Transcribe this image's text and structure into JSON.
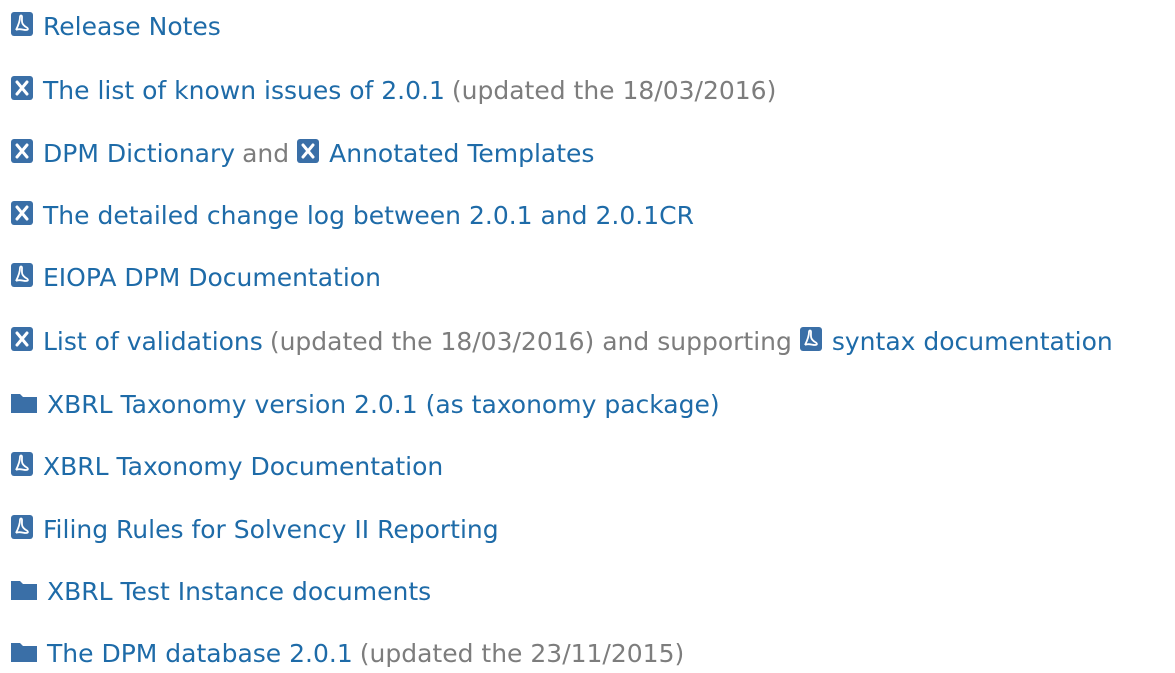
{
  "colors": {
    "link": "#1e6ba8",
    "text": "#7d7d7d",
    "icon": "#3a6fa7"
  },
  "items": [
    {
      "icon": "pdf-icon",
      "link": "Release Notes"
    },
    {
      "icon": "excel-icon",
      "link": "The list of known issues of 2.0.1",
      "note": "(updated the 18/03/2016)"
    },
    {
      "icon": "excel-icon",
      "link": "DPM Dictionary",
      "connector": "and",
      "icon2": "excel-icon",
      "link2": "Annotated Templates"
    },
    {
      "icon": "excel-icon",
      "link": "The detailed change log between 2.0.1 and 2.0.1CR"
    },
    {
      "icon": "pdf-icon",
      "link": "EIOPA DPM Documentation"
    },
    {
      "icon": "excel-icon",
      "link": "List of validations",
      "note": "(updated the 18/03/2016) and supporting",
      "icon2": "pdf-icon",
      "link2": "syntax documentation"
    },
    {
      "icon": "folder-icon",
      "link": "XBRL Taxonomy version 2.0.1 (as taxonomy package)"
    },
    {
      "icon": "pdf-icon",
      "link": "XBRL Taxonomy Documentation"
    },
    {
      "icon": "pdf-icon",
      "link": "Filing Rules for Solvency II Reporting"
    },
    {
      "icon": "folder-icon",
      "link": "XBRL Test Instance documents"
    },
    {
      "icon": "folder-icon",
      "link": "The DPM database 2.0.1",
      "note": "(updated the 23/11/2015)"
    }
  ]
}
